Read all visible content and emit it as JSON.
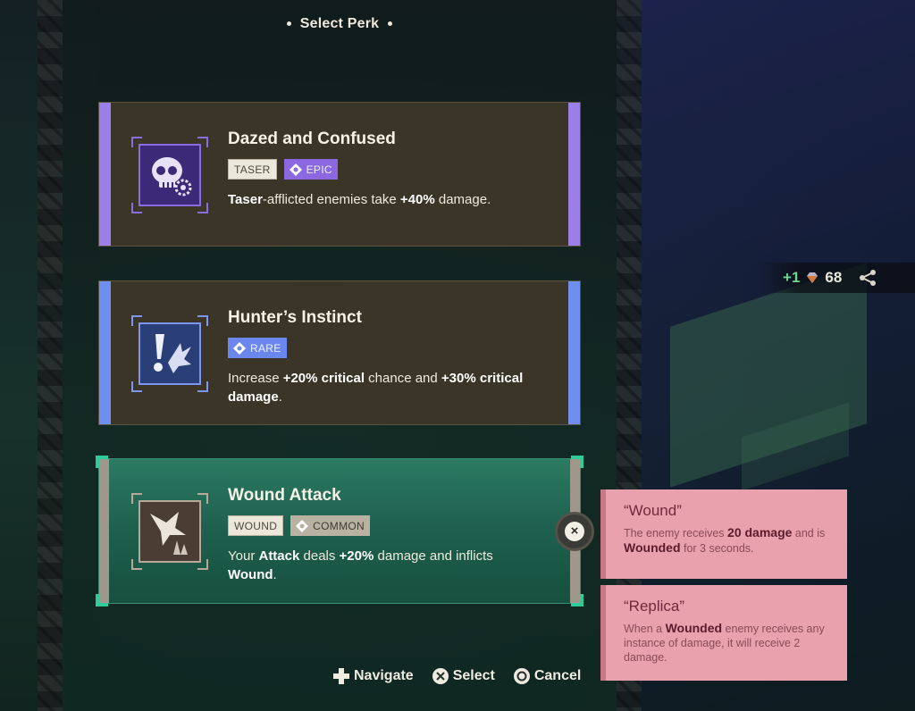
{
  "header": {
    "title": "Select Perk"
  },
  "perks": [
    {
      "title": "Dazed and Confused",
      "tags": [
        "TASER",
        "EPIC"
      ],
      "desc": [
        {
          "t": "Taser",
          "b": true
        },
        {
          "t": "-afflicted enemies take ",
          "b": false
        },
        {
          "t": "+40%",
          "b": true
        },
        {
          "t": " damage.",
          "b": false
        }
      ],
      "icon": "skull-gear-icon",
      "rarity_color": "#9b7ee8"
    },
    {
      "title": "Hunter’s Instinct",
      "tags": [
        "RARE"
      ],
      "desc": [
        {
          "t": "Increase ",
          "b": false
        },
        {
          "t": "+20% critical",
          "b": true
        },
        {
          "t": " chance and ",
          "b": false
        },
        {
          "t": "+30% critical damage",
          "b": true
        },
        {
          "t": ".",
          "b": false
        }
      ],
      "icon": "exclamation-burst-icon",
      "rarity_color": "#6f8ff0"
    },
    {
      "title": "Wound Attack",
      "tags": [
        "WOUND",
        "COMMON"
      ],
      "desc": [
        {
          "t": "Your ",
          "b": false
        },
        {
          "t": "Attack",
          "b": true
        },
        {
          "t": " deals ",
          "b": false
        },
        {
          "t": "+20%",
          "b": true
        },
        {
          "t": " damage and inflicts ",
          "b": false
        },
        {
          "t": "Wound",
          "b": true
        },
        {
          "t": ".",
          "b": false
        }
      ],
      "icon": "claw-crystal-icon",
      "rarity_color": "#9f978a",
      "selected": true
    }
  ],
  "tooltips": [
    {
      "title": "“Wound”",
      "body": [
        {
          "t": "The enemy receives ",
          "b": false
        },
        {
          "t": "20 damage",
          "b": true
        },
        {
          "t": " and is ",
          "b": false
        },
        {
          "t": "Wounded",
          "b": true
        },
        {
          "t": " for 3 seconds.",
          "b": false
        }
      ]
    },
    {
      "title": "“Replica”",
      "body": [
        {
          "t": "When a ",
          "b": false
        },
        {
          "t": "Wounded",
          "b": true
        },
        {
          "t": " enemy receives any instance of damage, it will receive 2 damage.",
          "b": false
        }
      ]
    }
  ],
  "resource": {
    "gain": "+1",
    "count": "68"
  },
  "controls": {
    "navigate": "Navigate",
    "select": "Select",
    "cancel": "Cancel"
  },
  "close_label": "×"
}
